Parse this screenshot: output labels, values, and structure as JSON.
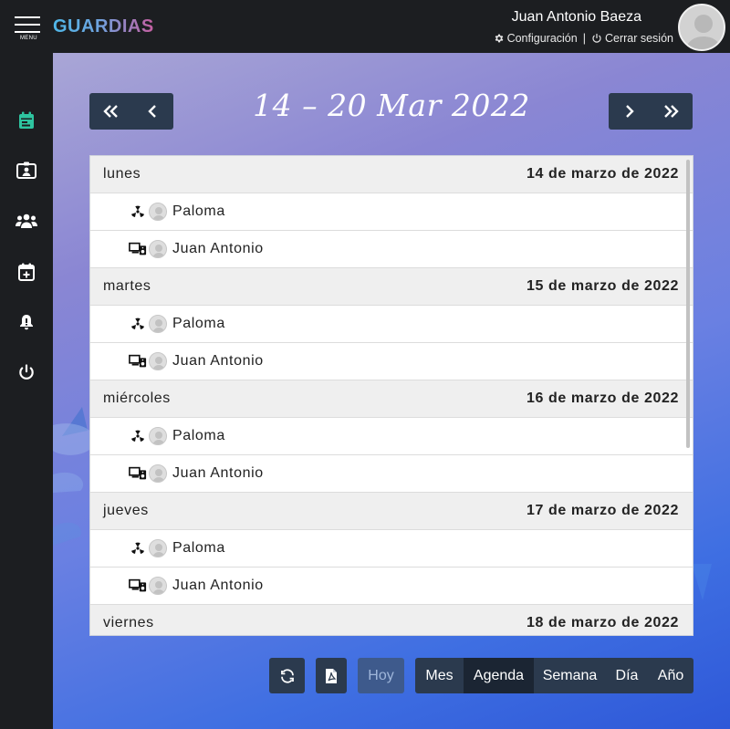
{
  "app": {
    "brand": "GUARDIAS",
    "menu_label": "MENU"
  },
  "user": {
    "name": "Juan Antonio Baeza",
    "settings_label": "Configuración",
    "separator": "|",
    "logout_label": "Cerrar sesión"
  },
  "sidebar": {
    "items": [
      {
        "name": "calendar",
        "icon": "calendar-icon",
        "active": true
      },
      {
        "name": "contact-card",
        "icon": "id-card-icon"
      },
      {
        "name": "users",
        "icon": "users-icon"
      },
      {
        "name": "add-event",
        "icon": "calendar-plus-icon"
      },
      {
        "name": "notifications",
        "icon": "bell-icon"
      },
      {
        "name": "power",
        "icon": "power-icon"
      }
    ]
  },
  "calendar": {
    "title": "14 – 20 Mar 2022",
    "days": [
      {
        "name": "lunes",
        "date": "14 de marzo de 2022",
        "events": [
          {
            "person": "Paloma",
            "icon": "radiation-icon"
          },
          {
            "person": "Juan Antonio",
            "icon": "devices-icon"
          }
        ]
      },
      {
        "name": "martes",
        "date": "15 de marzo de 2022",
        "events": [
          {
            "person": "Paloma",
            "icon": "radiation-icon"
          },
          {
            "person": "Juan Antonio",
            "icon": "devices-icon"
          }
        ]
      },
      {
        "name": "miércoles",
        "date": "16 de marzo de 2022",
        "events": [
          {
            "person": "Paloma",
            "icon": "radiation-icon"
          },
          {
            "person": "Juan Antonio",
            "icon": "devices-icon"
          }
        ]
      },
      {
        "name": "jueves",
        "date": "17 de marzo de 2022",
        "events": [
          {
            "person": "Paloma",
            "icon": "radiation-icon"
          },
          {
            "person": "Juan Antonio",
            "icon": "devices-icon"
          }
        ]
      },
      {
        "name": "viernes",
        "date": "18 de marzo de 2022",
        "events": []
      }
    ]
  },
  "toolbar": {
    "today_label": "Hoy",
    "views": [
      "Mes",
      "Agenda",
      "Semana",
      "Día",
      "Año"
    ],
    "active_view": "Agenda"
  },
  "colors": {
    "accent": "#2ec4a0",
    "dark": "#1c1e21",
    "button": "#2b3a4e"
  }
}
